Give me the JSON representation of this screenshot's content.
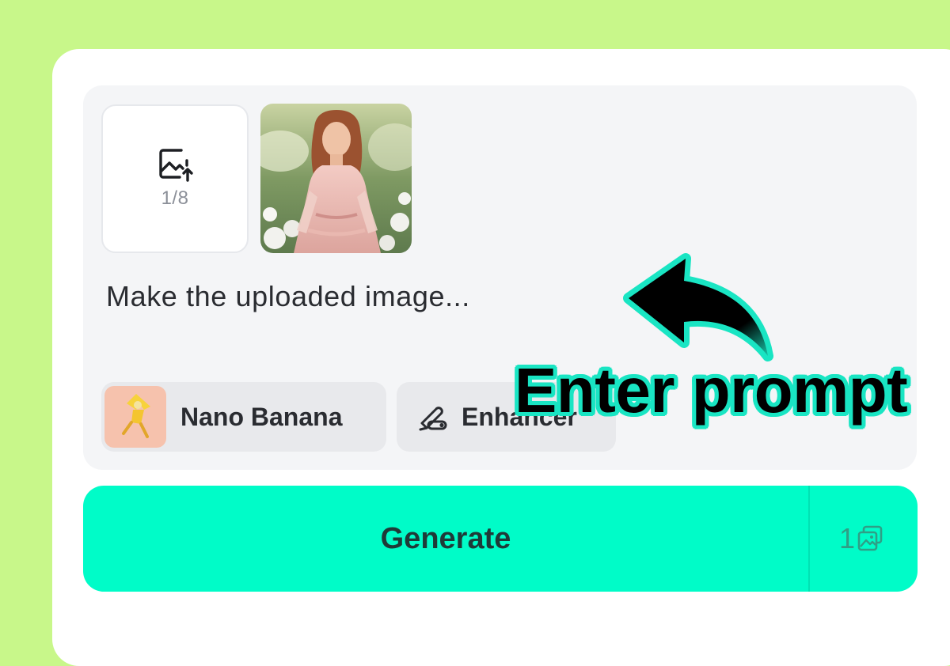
{
  "upload": {
    "count": "1/8",
    "icon": "image-upload-icon"
  },
  "prompt": {
    "text": "Make the uploaded image..."
  },
  "toolbar": {
    "model_label": "Nano Banana",
    "enhancer_label": "Enhancer",
    "enhancer_icon": "magic-wand-icon"
  },
  "generate": {
    "label": "Generate",
    "count": "1",
    "count_icon": "images-icon"
  },
  "overlay": {
    "label": "Enter prompt"
  },
  "colors": {
    "page_bg": "#c8f78a",
    "accent": "#00fcc8",
    "overlay_outline": "#19e5c3"
  }
}
